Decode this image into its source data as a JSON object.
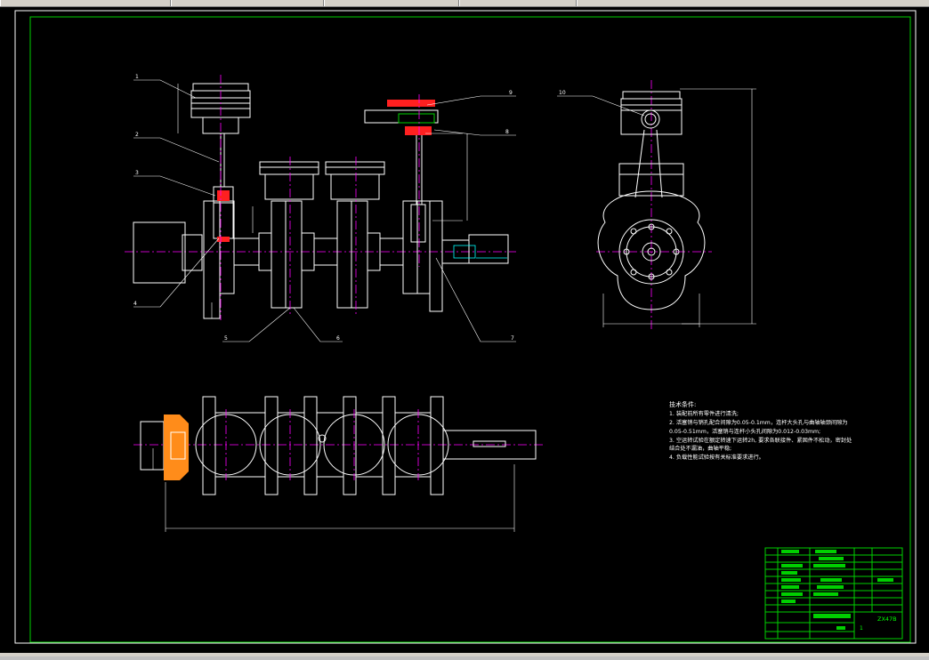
{
  "colors": {
    "background": "#000000",
    "frame": "#ffffff",
    "border": "#00ff00",
    "centerline": "#ff00ff",
    "section": "#ff2020"
  },
  "balloons": [
    "1",
    "2",
    "3",
    "4",
    "5",
    "6",
    "7",
    "8",
    "9",
    "10"
  ],
  "tech_req": {
    "title": "技术条件:",
    "lines": [
      "1. 装配前所有零件进行清洗;",
      "2. 活塞销与销孔配合间隙为0.05-0.1mm，连杆大头孔与曲轴轴颈间隙为",
      "0.05-0.51mm，活塞销与连杆小头孔间隙为0.012-0.03mm;",
      "3. 空运转试验在额定转速下运转2h, 要求各联接件、紧固件不松动，密封处",
      "结合处不漏油，曲轴平稳;",
      "4. 负载性能试验按有关标准要求进行。"
    ]
  },
  "title_block": {
    "drawing_code": "ZX47B",
    "sheet_label": "1"
  }
}
